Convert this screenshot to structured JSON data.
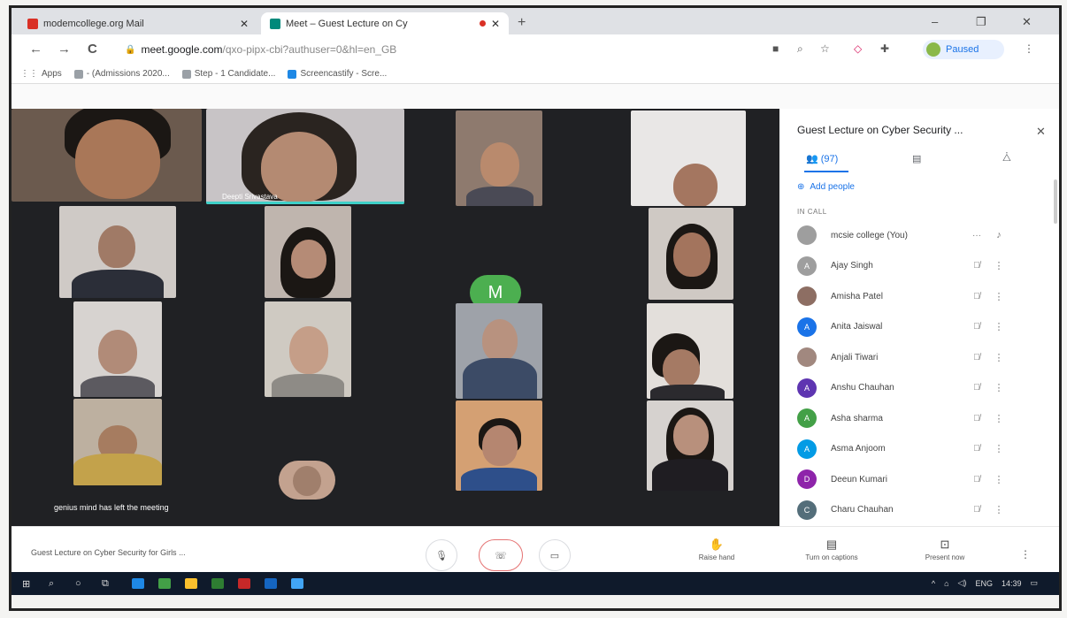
{
  "browser": {
    "tabs": [
      {
        "title": "modemcollege.org Mail",
        "favicon_color": "#d93025",
        "active": false
      },
      {
        "title": "Meet – Guest Lecture on Cy",
        "favicon_color": "#00897b",
        "active": true,
        "recording": true
      }
    ],
    "new_tab_icon": "+",
    "window_controls": [
      "–",
      "❐",
      "✕"
    ],
    "nav": {
      "back": "←",
      "forward": "→",
      "reload": "C"
    },
    "url": {
      "host": "meet.google.com",
      "path": "/qxo-pipx-cbi?authuser=0&hl=en_GB"
    },
    "profile_status": "Paused",
    "bookmarks": [
      "Apps",
      "- (Admissions 2020...",
      "Step - 1 Candidate...",
      "Screencastify - Scre..."
    ]
  },
  "meet": {
    "tiles": [
      {
        "id": "t1",
        "name": ""
      },
      {
        "id": "t2",
        "name": "Deepti Srivastava",
        "speaking": true
      },
      {
        "id": "t3",
        "name": ""
      },
      {
        "id": "t4",
        "name": ""
      },
      {
        "id": "t5",
        "name": ""
      },
      {
        "id": "t6",
        "name": ""
      },
      {
        "id": "t7",
        "name": ""
      },
      {
        "id": "t8",
        "name": ""
      },
      {
        "id": "t9",
        "name": ""
      },
      {
        "id": "t10",
        "name": ""
      },
      {
        "id": "t11",
        "name": ""
      },
      {
        "id": "t12",
        "name": ""
      },
      {
        "id": "t13",
        "name": ""
      },
      {
        "id": "t14",
        "name": ""
      }
    ],
    "avatar_letter": "M",
    "avatar_color": "#4caf50",
    "toast": "genius mind has left the meeting"
  },
  "panel": {
    "title": "Guest Lecture on Cyber Security ...",
    "people_count": "(97)",
    "add_people": "Add people",
    "section_label": "IN CALL",
    "participants": [
      {
        "name": "mcsie college (You)",
        "initial": "",
        "color": "#9e9e9e"
      },
      {
        "name": "Ajay Singh",
        "initial": "A",
        "color": "#9e9e9e"
      },
      {
        "name": "Amisha Patel",
        "initial": "",
        "color": "#8d6e63"
      },
      {
        "name": "Anita Jaiswal",
        "initial": "A",
        "color": "#1a73e8"
      },
      {
        "name": "Anjali Tiwari",
        "initial": "",
        "color": "#a1887f"
      },
      {
        "name": "Anshu Chauhan",
        "initial": "A",
        "color": "#5e35b1"
      },
      {
        "name": "Asha sharma",
        "initial": "A",
        "color": "#43a047"
      },
      {
        "name": "Asma Anjoom",
        "initial": "A",
        "color": "#039be5"
      },
      {
        "name": "Deeun Kumari",
        "initial": "D",
        "color": "#8e24aa"
      },
      {
        "name": "Charu Chauhan",
        "initial": "C",
        "color": "#546e7a"
      }
    ]
  },
  "bottom": {
    "meeting_title": "Guest Lecture on Cyber Security for Girls ...",
    "actions": [
      {
        "label": "Raise hand",
        "icon": "hand-icon"
      },
      {
        "label": "Turn on captions",
        "icon": "captions-icon"
      },
      {
        "label": "Present now",
        "icon": "present-icon"
      }
    ]
  },
  "taskbar": {
    "tray": [
      "^",
      "ENG",
      "14:39"
    ]
  }
}
